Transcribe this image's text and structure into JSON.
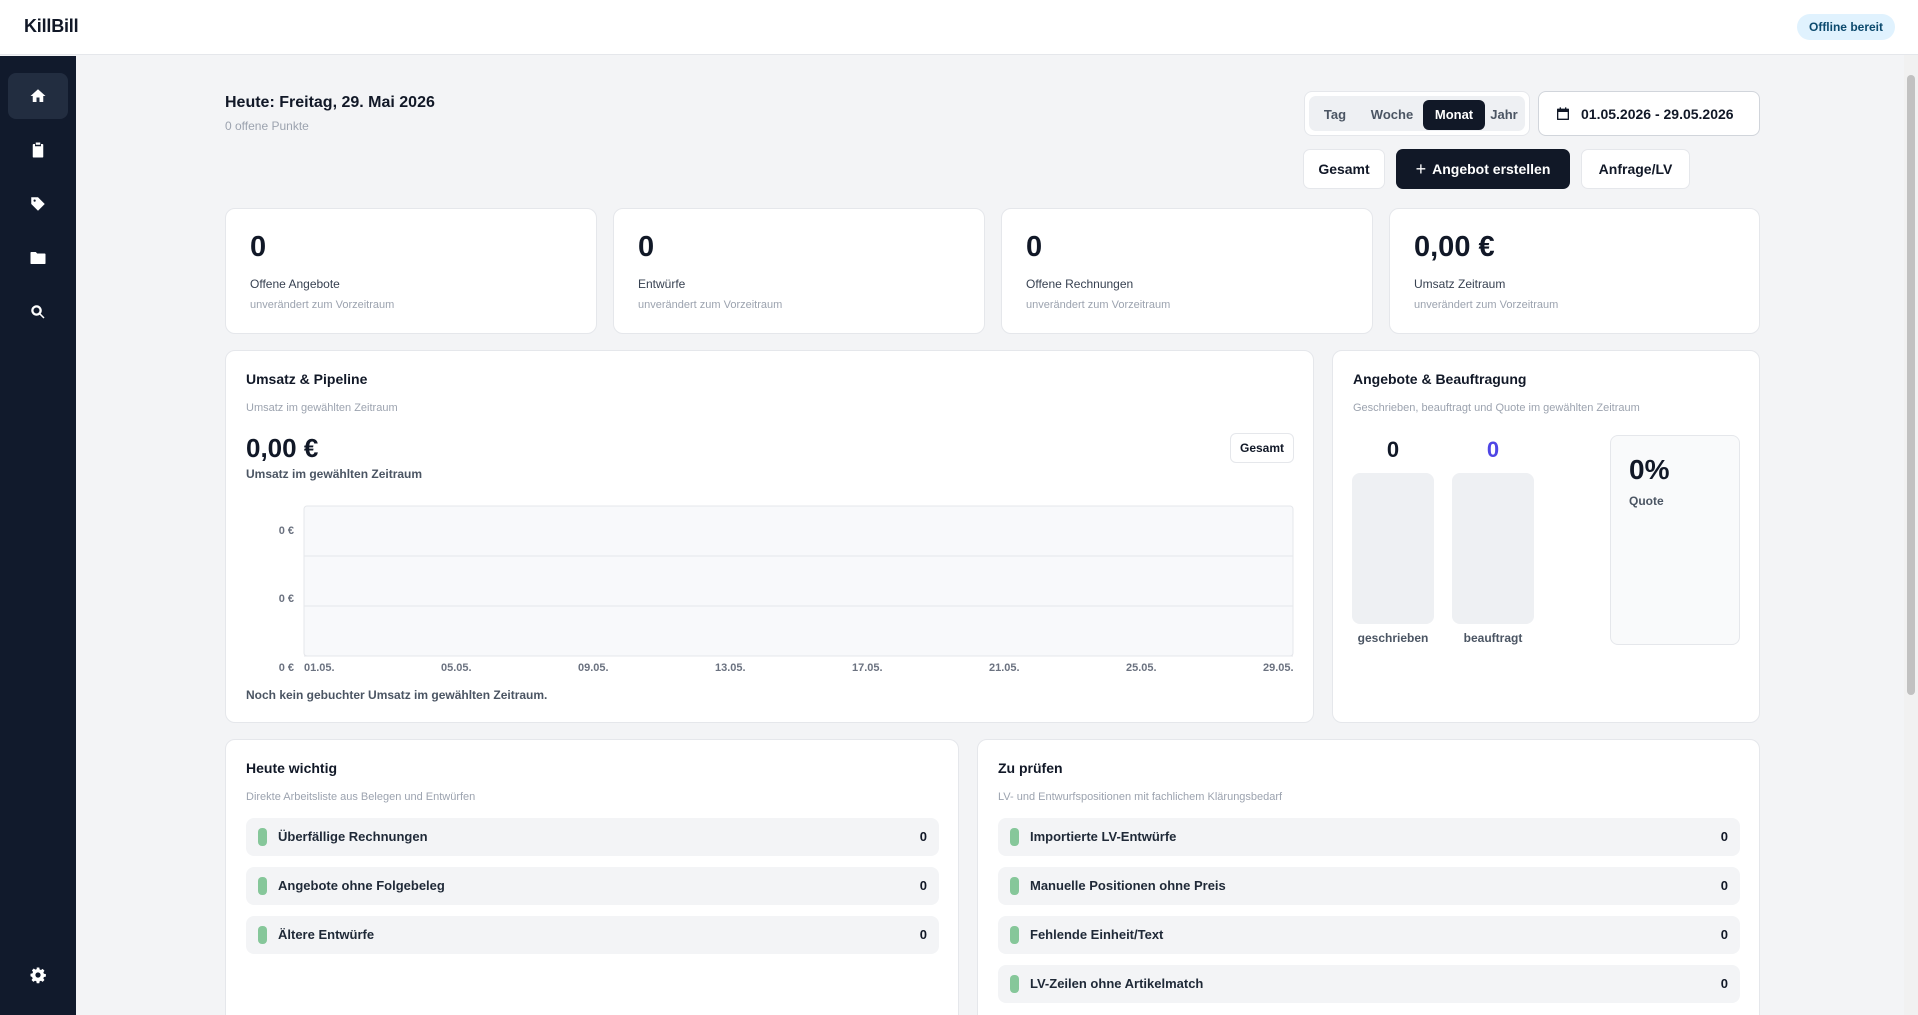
{
  "app": {
    "title": "KillBill",
    "status_badge": "Offline bereit"
  },
  "sidebar": {
    "items": [
      {
        "name": "home",
        "icon": "home-icon",
        "active": true
      },
      {
        "name": "documents",
        "icon": "clipboard-icon",
        "active": false
      },
      {
        "name": "articles",
        "icon": "tag-icon",
        "active": false
      },
      {
        "name": "projects",
        "icon": "folder-icon",
        "active": false
      },
      {
        "name": "search",
        "icon": "search-icon",
        "active": false
      }
    ],
    "settings_icon": "gear-icon"
  },
  "header": {
    "today": "Heute: Freitag, 29. Mai 2026",
    "open_items": "0 offene Punkte",
    "periods": [
      "Tag",
      "Woche",
      "Monat",
      "Jahr"
    ],
    "active_period": "Monat",
    "date_range": "01.05.2026 - 29.05.2026",
    "actions": {
      "total": "Gesamt",
      "create_offer": "Angebot erstellen",
      "request": "Anfrage/LV"
    }
  },
  "kpis": [
    {
      "value": "0",
      "label": "Offene Angebote",
      "note": "unverändert zum Vorzeitraum"
    },
    {
      "value": "0",
      "label": "Entwürfe",
      "note": "unverändert zum Vorzeitraum"
    },
    {
      "value": "0",
      "label": "Offene Rechnungen",
      "note": "unverändert zum Vorzeitraum"
    },
    {
      "value": "0,00 €",
      "label": "Umsatz Zeitraum",
      "note": "unverändert zum Vorzeitraum"
    }
  ],
  "revenue": {
    "title": "Umsatz & Pipeline",
    "subtitle": "Umsatz im gewählten Zeitraum",
    "value": "0,00 €",
    "value_label": "Umsatz im gewählten Zeitraum",
    "toggle": "Gesamt",
    "empty_message": "Noch kein gebuchter Umsatz im gewählten Zeitraum."
  },
  "chart_data": {
    "type": "area",
    "x": [
      "01.05.",
      "05.05.",
      "09.05.",
      "13.05.",
      "17.05.",
      "21.05.",
      "25.05.",
      "29.05."
    ],
    "y_ticks": [
      "0 €",
      "0 €",
      "0 €"
    ],
    "values": [
      0,
      0,
      0,
      0,
      0,
      0,
      0,
      0
    ],
    "grid": true
  },
  "offers": {
    "title": "Angebote & Beauftragung",
    "subtitle": "Geschrieben, beauftragt und Quote im gewählten Zeitraum",
    "written_value": "0",
    "written_label": "geschrieben",
    "ordered_value": "0",
    "ordered_label": "beauftragt",
    "quote_value": "0%",
    "quote_label": "Quote",
    "accent_color": "#4f46e5"
  },
  "today_important": {
    "title": "Heute wichtig",
    "subtitle": "Direkte Arbeitsliste aus Belegen und Entwürfen",
    "items": [
      {
        "label": "Überfällige Rechnungen",
        "count": "0"
      },
      {
        "label": "Angebote ohne Folgebeleg",
        "count": "0"
      },
      {
        "label": "Ältere Entwürfe",
        "count": "0"
      }
    ]
  },
  "to_check": {
    "title": "Zu prüfen",
    "subtitle": "LV- und Entwurfspositionen mit fachlichem Klärungsbedarf",
    "items": [
      {
        "label": "Importierte LV-Entwürfe",
        "count": "0"
      },
      {
        "label": "Manuelle Positionen ohne Preis",
        "count": "0"
      },
      {
        "label": "Fehlende Einheit/Text",
        "count": "0"
      },
      {
        "label": "LV-Zeilen ohne Artikelmatch",
        "count": "0"
      }
    ]
  }
}
